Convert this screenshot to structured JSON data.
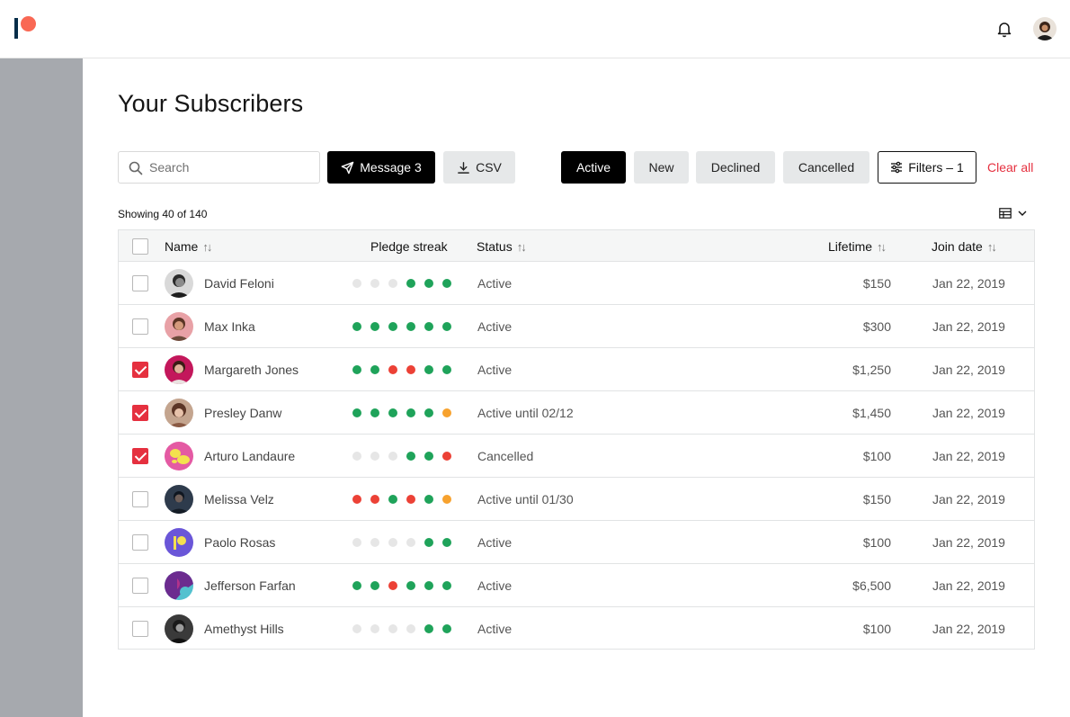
{
  "header": {
    "logo": "patreon-logo"
  },
  "page": {
    "title": "Your Subscribers"
  },
  "toolbar": {
    "search_placeholder": "Search",
    "message_label": "Message 3",
    "csv_label": "CSV",
    "filter_tabs": [
      "Active",
      "New",
      "Declined",
      "Cancelled"
    ],
    "active_tab": "Active",
    "filters_label": "Filters – 1",
    "clear_all_label": "Clear all"
  },
  "showing": "Showing 40 of 140",
  "table": {
    "columns": {
      "name": "Name",
      "pledge_streak": "Pledge streak",
      "status": "Status",
      "lifetime": "Lifetime",
      "join_date": "Join date"
    },
    "rows": [
      {
        "name": "David Feloni",
        "streak": [
          "none",
          "none",
          "none",
          "green",
          "green",
          "green"
        ],
        "status": "Active",
        "lifetime": "$150",
        "join_date": "Jan 22, 2019",
        "checked": false,
        "avatar": "photo-bw"
      },
      {
        "name": "Max Inka",
        "streak": [
          "green",
          "green",
          "green",
          "green",
          "green",
          "green"
        ],
        "status": "Active",
        "lifetime": "$300",
        "join_date": "Jan 22, 2019",
        "checked": false,
        "avatar": "photo-pink"
      },
      {
        "name": "Margareth Jones",
        "streak": [
          "green",
          "green",
          "red",
          "red",
          "green",
          "green"
        ],
        "status": "Active",
        "lifetime": "$1,250",
        "join_date": "Jan 22, 2019",
        "checked": true,
        "avatar": "photo-magenta"
      },
      {
        "name": "Presley Danw",
        "streak": [
          "green",
          "green",
          "green",
          "green",
          "green",
          "orange"
        ],
        "status": "Active until 02/12",
        "lifetime": "$1,450",
        "join_date": "Jan 22, 2019",
        "checked": true,
        "avatar": "photo-warm"
      },
      {
        "name": "Arturo Landaure",
        "streak": [
          "none",
          "none",
          "none",
          "green",
          "green",
          "red"
        ],
        "status": "Cancelled",
        "lifetime": "$100",
        "join_date": "Jan 22, 2019",
        "checked": true,
        "avatar": "art-pink-yellow"
      },
      {
        "name": "Melissa Velz",
        "streak": [
          "red",
          "red",
          "green",
          "red",
          "green",
          "orange"
        ],
        "status": "Active until 01/30",
        "lifetime": "$150",
        "join_date": "Jan 22, 2019",
        "checked": false,
        "avatar": "photo-dark"
      },
      {
        "name": "Paolo Rosas",
        "streak": [
          "none",
          "none",
          "none",
          "none",
          "green",
          "green"
        ],
        "status": "Active",
        "lifetime": "$100",
        "join_date": "Jan 22, 2019",
        "checked": false,
        "avatar": "logo-purple"
      },
      {
        "name": "Jefferson Farfan",
        "streak": [
          "green",
          "green",
          "red",
          "green",
          "green",
          "green"
        ],
        "status": "Active",
        "lifetime": "$6,500",
        "join_date": "Jan 22, 2019",
        "checked": false,
        "avatar": "art-teal-purple"
      },
      {
        "name": "Amethyst Hills",
        "streak": [
          "none",
          "none",
          "none",
          "none",
          "green",
          "green"
        ],
        "status": "Active",
        "lifetime": "$100",
        "join_date": "Jan 22, 2019",
        "checked": false,
        "avatar": "photo-bw2"
      }
    ]
  },
  "colors": {
    "accent_red": "#e5303f",
    "streak_green": "#1fa35a",
    "streak_red": "#ec4136",
    "streak_orange": "#f7a22e",
    "streak_none": "#e6e6e6",
    "brand_coral": "#f96854",
    "brand_navy": "#052d49"
  }
}
